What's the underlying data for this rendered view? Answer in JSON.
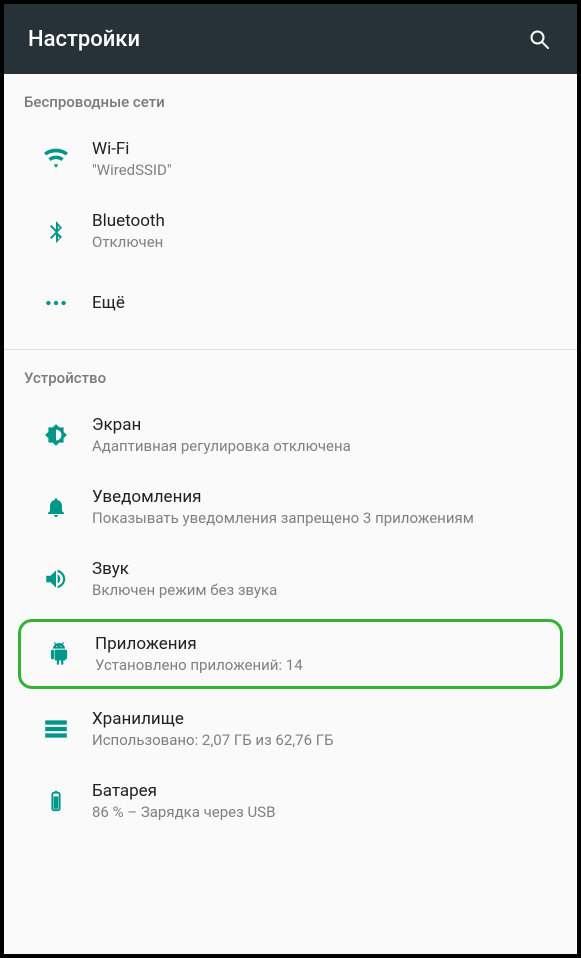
{
  "appbar": {
    "title": "Настройки"
  },
  "colors": {
    "accent": "#009688",
    "appbar_bg": "#263238",
    "highlight_border": "#34b233"
  },
  "sections": [
    {
      "header": "Беспроводные сети",
      "items": [
        {
          "id": "wifi",
          "title": "Wi-Fi",
          "subtitle": "\"WiredSSID\""
        },
        {
          "id": "bluetooth",
          "title": "Bluetooth",
          "subtitle": "Отключен"
        },
        {
          "id": "more",
          "title": "Ещё",
          "subtitle": ""
        }
      ]
    },
    {
      "header": "Устройство",
      "items": [
        {
          "id": "display",
          "title": "Экран",
          "subtitle": "Адаптивная регулировка отключена"
        },
        {
          "id": "notifications",
          "title": "Уведомления",
          "subtitle": "Показывать уведомления запрещено 3 приложениям"
        },
        {
          "id": "sound",
          "title": "Звук",
          "subtitle": "Включен режим без звука"
        },
        {
          "id": "apps",
          "title": "Приложения",
          "subtitle": "Установлено приложений: 14",
          "highlighted": true
        },
        {
          "id": "storage",
          "title": "Хранилище",
          "subtitle": "Использовано: 2,07 ГБ из 62,76 ГБ"
        },
        {
          "id": "battery",
          "title": "Батарея",
          "subtitle": "86 % – Зарядка через USB"
        }
      ]
    }
  ]
}
